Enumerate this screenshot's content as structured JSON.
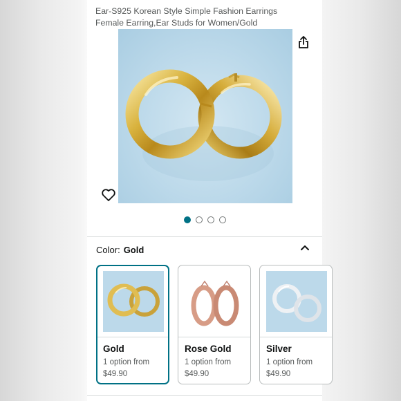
{
  "product": {
    "title": "Ear-S925 Korean Style Simple Fashion Earrings Female Earring,Ear Studs for Women/Gold",
    "image_count": 4,
    "active_image_index": 0
  },
  "icons": {
    "share": "share-icon",
    "favorite": "heart-icon",
    "collapse": "chevron-up-icon"
  },
  "variation": {
    "label": "Color:",
    "selected": "Gold"
  },
  "options": [
    {
      "name": "Gold",
      "availability": "1 option from",
      "price": "$49.90",
      "selected": true,
      "metal_color": "#d8b440"
    },
    {
      "name": "Rose Gold",
      "availability": "1 option from",
      "price": "$49.90",
      "selected": false,
      "metal_color": "#d9a48e"
    },
    {
      "name": "Silver",
      "availability": "1 option from",
      "price": "$49.90",
      "selected": false,
      "metal_color": "#e4e8ec"
    }
  ],
  "colors": {
    "accent": "#007185",
    "text": "#0f1111",
    "secondary_text": "#565959"
  }
}
